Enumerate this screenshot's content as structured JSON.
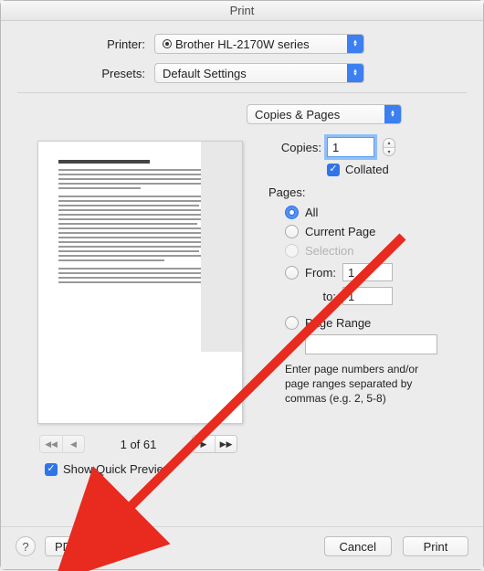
{
  "window": {
    "title": "Print"
  },
  "header": {
    "printer_label": "Printer:",
    "printer_value": "Brother HL-2170W series",
    "presets_label": "Presets:",
    "presets_value": "Default Settings"
  },
  "panel": {
    "section_value": "Copies & Pages"
  },
  "options": {
    "copies_label": "Copies:",
    "copies_value": "1",
    "collated_label": "Collated",
    "collated_checked": true,
    "pages_label": "Pages:",
    "radios": {
      "all": "All",
      "current": "Current Page",
      "selection": "Selection",
      "from": "From:",
      "to": "to:",
      "from_value": "1",
      "to_value": "1",
      "range": "Page Range"
    },
    "range_value": "",
    "hint": "Enter page numbers and/or page ranges separated by commas (e.g. 2, 5-8)"
  },
  "preview": {
    "page_indicator": "1 of 61",
    "show_quick_preview": "Show Quick Preview",
    "show_quick_preview_checked": true
  },
  "footer": {
    "help": "?",
    "pdf": "PDF",
    "cancel": "Cancel",
    "print": "Print"
  }
}
